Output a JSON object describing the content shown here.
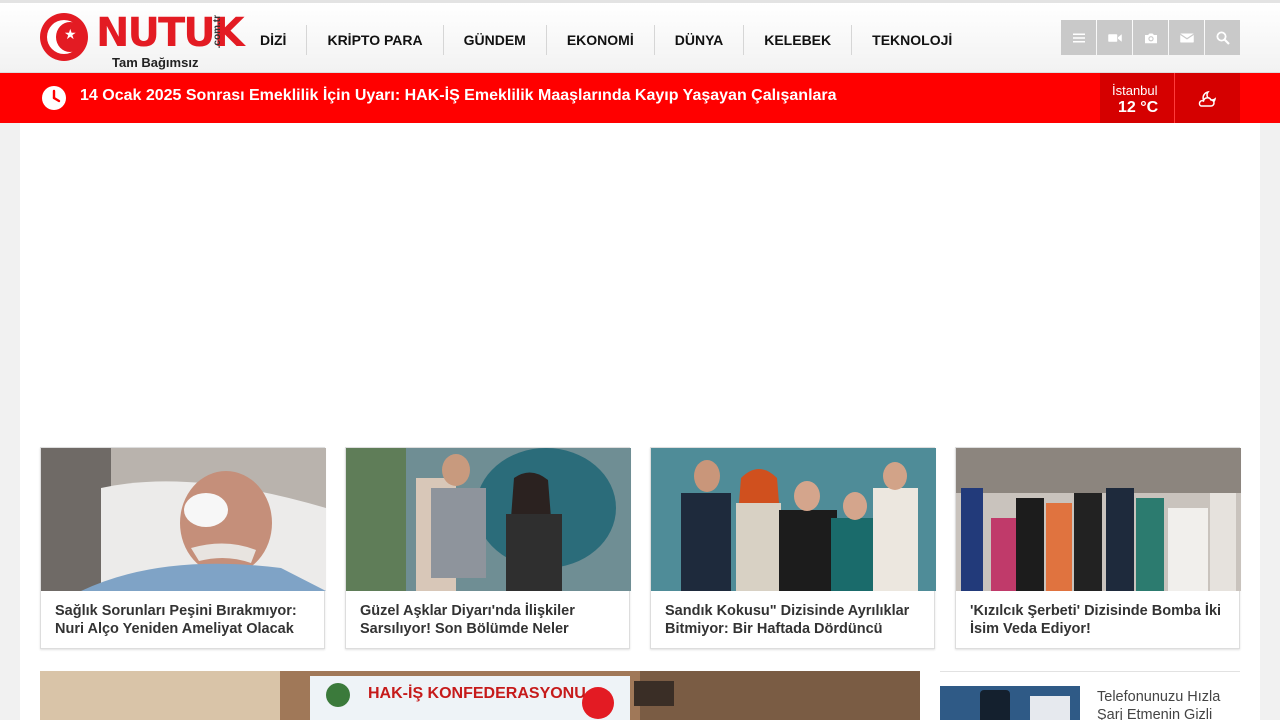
{
  "header": {
    "logo": {
      "word": "NUTUK",
      "domain": ".com.tr",
      "tagline": "Tam Bağımsız",
      "color": "#e31b23"
    },
    "nav": [
      "DİZİ",
      "KRİPTO PARA",
      "GÜNDEM",
      "EKONOMİ",
      "DÜNYA",
      "KELEBEK",
      "TEKNOLOJİ"
    ],
    "tools": [
      "menu-icon",
      "video-icon",
      "camera-icon",
      "mail-icon",
      "search-icon"
    ]
  },
  "breaking": {
    "text": "14 Ocak 2025 Sonrası Emeklilik İçin Uyarı: HAK-İŞ Emeklilik Maaşlarında Kayıp Yaşayan Çalışanlara",
    "bg_color": "#ff0000"
  },
  "weather": {
    "city": "İstanbul",
    "temp": "12 °C",
    "icon": "cloud-moon-icon"
  },
  "cards": [
    {
      "title": "Sağlık Sorunları Peşini Bırakmıyor: Nuri Alço Yeniden Ameliyat Olacak"
    },
    {
      "title": "Güzel Aşklar Diyarı'nda İlişkiler Sarsılıyor! Son Bölümde Neler"
    },
    {
      "title": "Sandık Kokusu\" Dizisinde Ayrılıklar Bitmiyor: Bir Haftada Dördüncü"
    },
    {
      "title": "'Kızılcık Şerbeti' Dizisinde Bomba İki İsim Veda Ediyor!"
    }
  ],
  "main_story": {
    "banner_text": "HAK-İŞ KONFEDERASYONU"
  },
  "sidebar": {
    "first_title": "Telefonunuzu Hızla Şarj Etmenin Gizli"
  }
}
